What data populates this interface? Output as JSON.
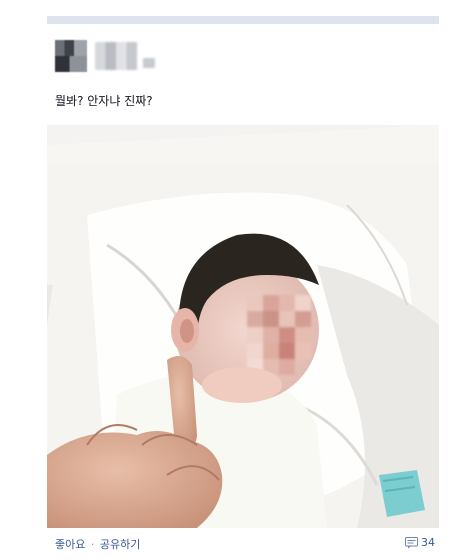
{
  "post": {
    "text": "뭘봐? 안자냐 진짜?"
  },
  "footer": {
    "like_label": "좋아요",
    "separator": "·",
    "share_label": "공유하기",
    "comment_count": "34"
  },
  "icons": {
    "comment": "comment-bubble-icon"
  },
  "colors": {
    "link": "#3b5998",
    "text": "#141823",
    "bar": "#dfe3ee"
  }
}
